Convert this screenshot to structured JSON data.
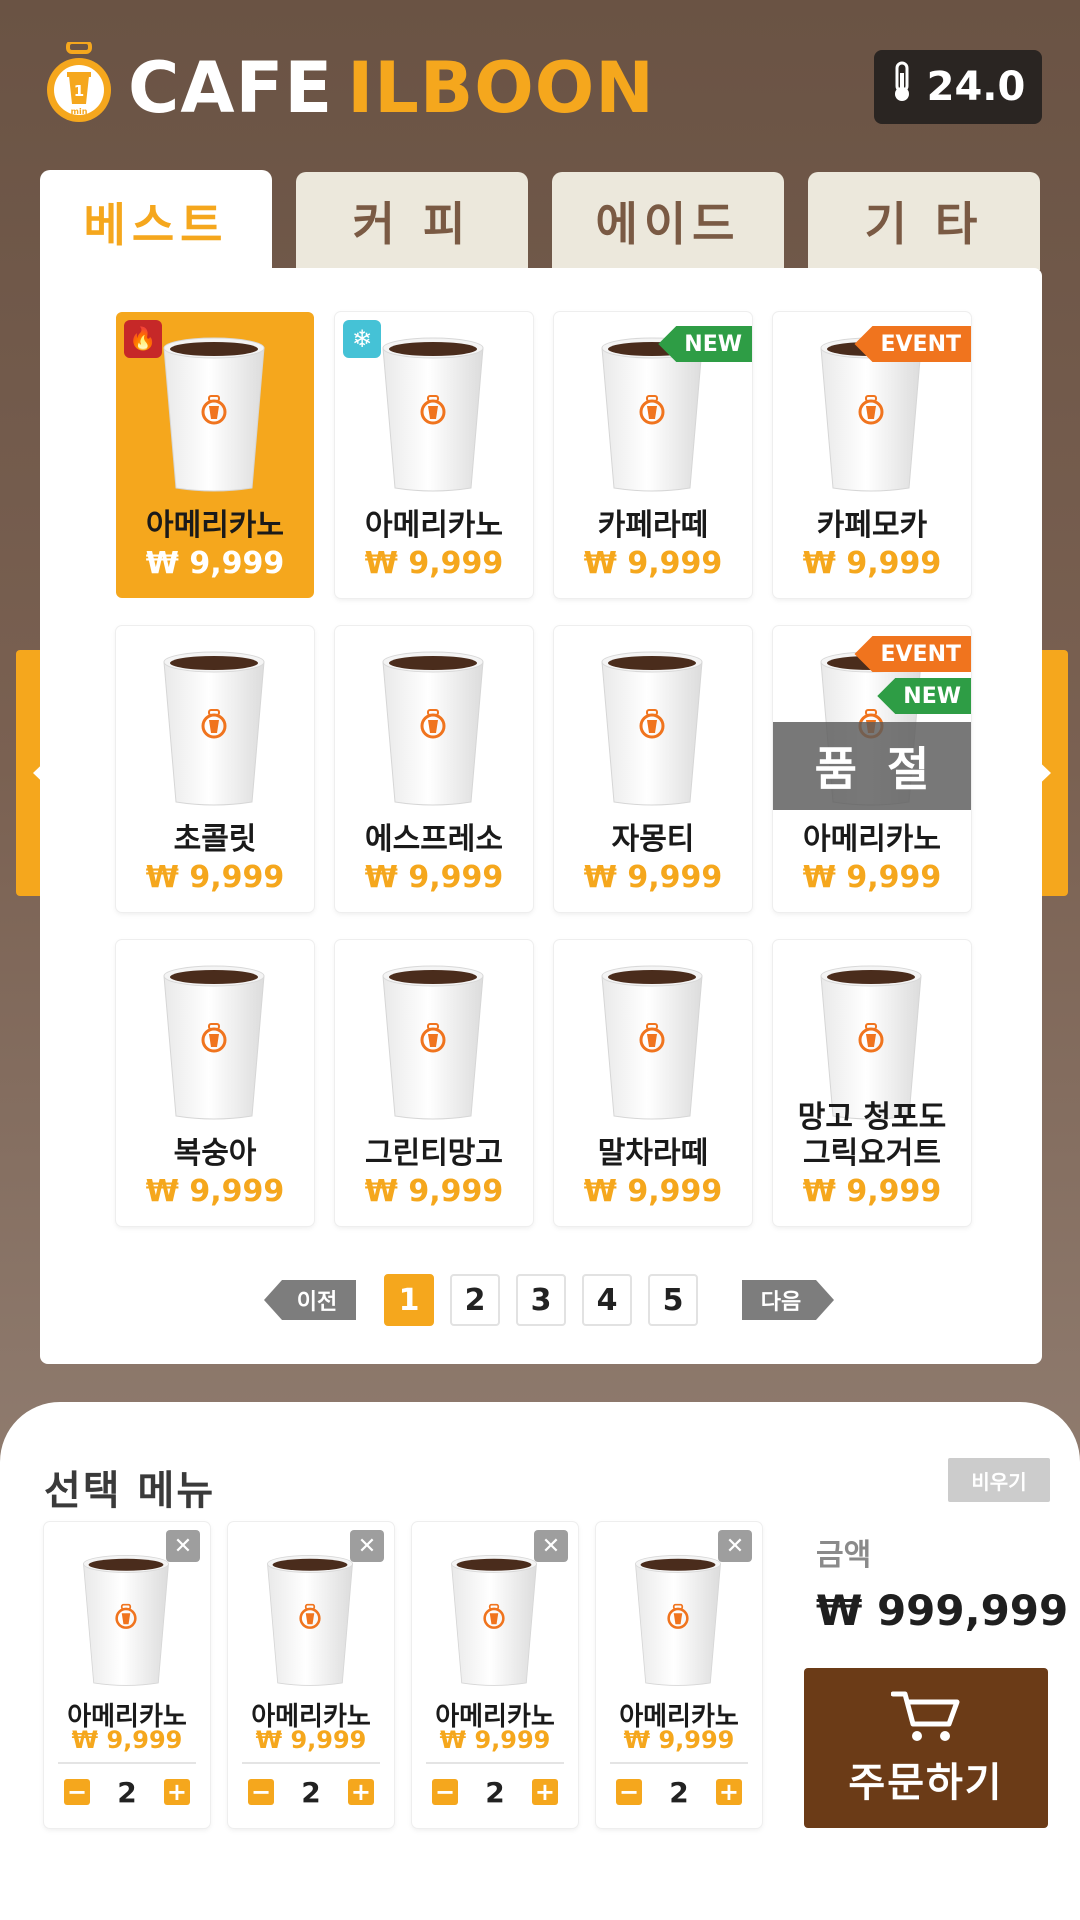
{
  "header": {
    "logo_text": "1 min",
    "brand_word1": "CAFE",
    "brand_word2": "ILBOON",
    "temperature": "24.0"
  },
  "tabs": [
    {
      "label": "베스트",
      "active": true
    },
    {
      "label": "커 피",
      "active": false
    },
    {
      "label": "에이드",
      "active": false
    },
    {
      "label": "기 타",
      "active": false
    }
  ],
  "products": [
    {
      "name": "아메리카노",
      "price": "₩ 9,999",
      "badge": "hot",
      "selected": true
    },
    {
      "name": "아메리카노",
      "price": "₩ 9,999",
      "badge": "ice"
    },
    {
      "name": "카페라떼",
      "price": "₩ 9,999",
      "ribbons": [
        "NEW"
      ]
    },
    {
      "name": "카페모카",
      "price": "₩ 9,999",
      "ribbons": [
        "EVENT"
      ]
    },
    {
      "name": "초콜릿",
      "price": "₩ 9,999"
    },
    {
      "name": "에스프레소",
      "price": "₩ 9,999"
    },
    {
      "name": "자몽티",
      "price": "₩ 9,999"
    },
    {
      "name": "아메리카노",
      "price": "₩ 9,999",
      "ribbons": [
        "EVENT",
        "NEW"
      ],
      "soldout": "품절"
    },
    {
      "name": "복숭아",
      "price": "₩ 9,999"
    },
    {
      "name": "그린티망고",
      "price": "₩ 9,999"
    },
    {
      "name": "말차라떼",
      "price": "₩ 9,999"
    },
    {
      "name": "망고 청포도\n그릭요거트",
      "price": "₩ 9,999"
    }
  ],
  "pagination": {
    "prev_label": "이전",
    "next_label": "다음",
    "pages": [
      "1",
      "2",
      "3",
      "4",
      "5"
    ],
    "current": "1"
  },
  "order": {
    "title": "선택 메뉴",
    "clear_label": "비우기",
    "amount_label": "금액",
    "amount": "₩ 999,999",
    "order_button_label": "주문하기",
    "items": [
      {
        "name": "아메리카노",
        "price": "₩ 9,999",
        "qty": "2"
      },
      {
        "name": "아메리카노",
        "price": "₩ 9,999",
        "qty": "2"
      },
      {
        "name": "아메리카노",
        "price": "₩ 9,999",
        "qty": "2"
      },
      {
        "name": "아메리카노",
        "price": "₩ 9,999",
        "qty": "2"
      }
    ]
  },
  "colors": {
    "accent": "#f5a71d",
    "brown": "#6b3b17",
    "new_ribbon": "#2e9d45",
    "event_ribbon": "#f0741e"
  },
  "icons": {
    "temperature": "thermometer-icon",
    "hot": "fire-icon",
    "ice": "snowflake-icon",
    "remove": "close-icon",
    "cart": "cart-icon"
  }
}
